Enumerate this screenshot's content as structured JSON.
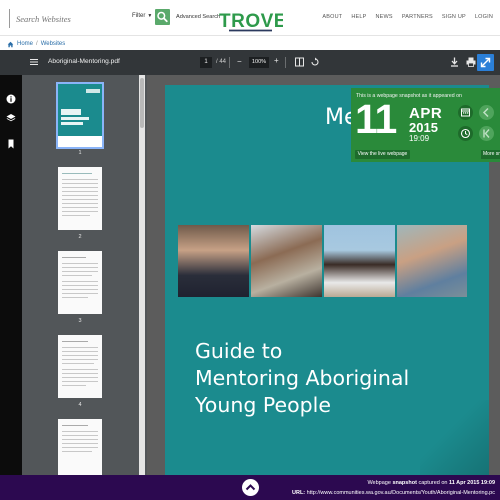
{
  "header": {
    "search_placeholder": "Search Websites",
    "filter_label": "Filter",
    "advanced_search": "Advanced Search",
    "logo_text": "TROVE",
    "nav": [
      "ABOUT",
      "HELP",
      "NEWS",
      "PARTNERS",
      "SIGN UP",
      "LOGIN"
    ]
  },
  "breadcrumb": {
    "home": "Home",
    "separator": "/",
    "current": "Websites"
  },
  "viewer": {
    "filename": "Aboriginal-Mentoring.pdf",
    "current_page": "1",
    "total_pages": "/ 44",
    "zoom": "100%",
    "thumb_pages": [
      "1",
      "2",
      "3",
      "4"
    ]
  },
  "page": {
    "top_text": "Me",
    "title_lines": [
      "Guide to",
      "Mentoring Aboriginal",
      "Young People"
    ]
  },
  "snapshot": {
    "caption": "This is a webpage snapshot as it appeared on",
    "day": "11",
    "month": "APR",
    "year": "2015",
    "time": "19:09",
    "live_button": "View the live webpage",
    "more_button": "More sn"
  },
  "footer": {
    "snapshot_prefix": "Webpage",
    "snapshot_word": "snapshot",
    "snapshot_mid": "captured on",
    "snapshot_date": "11 Apr 2015 19:09",
    "url_label": "URL:",
    "url": "http://www.communities.wa.gov.au/Documents/Youth/Aboriginal-Mentoring.pc"
  },
  "colors": {
    "trove_green": "#2e9a4b",
    "trove_navy": "#2b3a5e",
    "snapshot_green": "#2a8a3a",
    "page_teal": "#1b8b8e",
    "footer_purple": "#2c0950",
    "accent_blue": "#2b7fd7"
  }
}
